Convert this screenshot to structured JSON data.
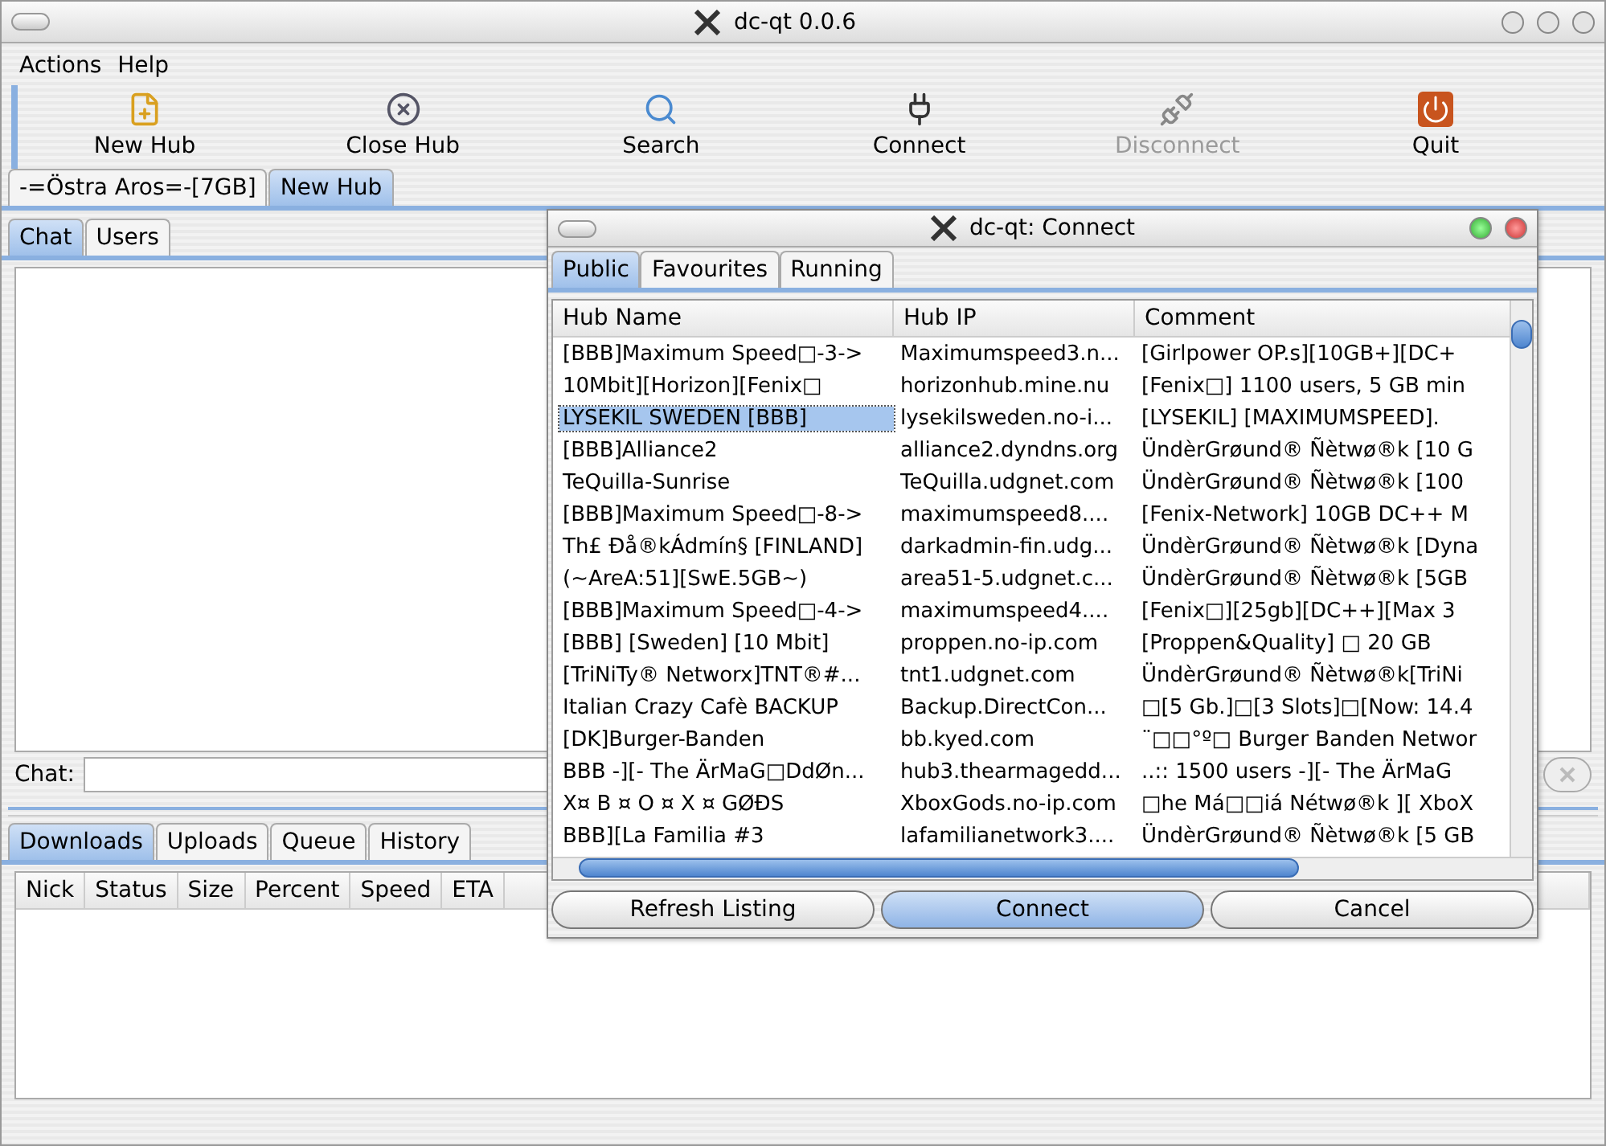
{
  "window": {
    "title": "dc-qt 0.0.6"
  },
  "menu": [
    "Actions",
    "Help"
  ],
  "toolbar": [
    {
      "label": "New Hub",
      "kind": "new",
      "disabled": false
    },
    {
      "label": "Close Hub",
      "kind": "close",
      "disabled": false
    },
    {
      "label": "Search",
      "kind": "search",
      "disabled": false
    },
    {
      "label": "Connect",
      "kind": "connect",
      "disabled": false
    },
    {
      "label": "Disconnect",
      "kind": "disconnect",
      "disabled": true
    },
    {
      "label": "Quit",
      "kind": "quit",
      "disabled": false
    }
  ],
  "hub_tabs": [
    {
      "label": "-=Östra Aros=-[7GB]",
      "selected": false
    },
    {
      "label": "New Hub",
      "selected": true
    }
  ],
  "chat_tabs": [
    {
      "label": "Chat",
      "selected": true
    },
    {
      "label": "Users",
      "selected": false
    }
  ],
  "chat_label": "Chat:",
  "transfer_tabs": [
    {
      "label": "Downloads",
      "selected": true
    },
    {
      "label": "Uploads",
      "selected": false
    },
    {
      "label": "Queue",
      "selected": false
    },
    {
      "label": "History",
      "selected": false
    }
  ],
  "transfer_columns": [
    "Nick",
    "Status",
    "Size",
    "Percent",
    "Speed",
    "ETA"
  ],
  "dialog": {
    "title": "dc-qt: Connect",
    "tabs": [
      {
        "label": "Public",
        "selected": true
      },
      {
        "label": "Favourites",
        "selected": false
      },
      {
        "label": "Running",
        "selected": false
      }
    ],
    "columns": [
      "Hub Name",
      "Hub IP",
      "Comment"
    ],
    "rows": [
      {
        "name": "[BBB]Maximum Speed□-3->",
        "ip": "Maximumspeed3.n...",
        "comment": "[Girlpower OP.s][10GB+][DC+",
        "selected": false
      },
      {
        "name": "10Mbit][Horizon][Fenix□",
        "ip": "horizonhub.mine.nu",
        "comment": "[Fenix□] 1100 users, 5 GB min",
        "selected": false
      },
      {
        "name": "LYSEKIL SWEDEN [BBB]",
        "ip": "lysekilsweden.no-i...",
        "comment": "[LYSEKIL]  [MAXIMUMSPEED].",
        "selected": true
      },
      {
        "name": "[BBB]Alliance2",
        "ip": "alliance2.dyndns.org",
        "comment": "ÜndèrGrøund® Ñètwø®k [10 G",
        "selected": false
      },
      {
        "name": "TeQuilla-Sunrise",
        "ip": "TeQuilla.udgnet.com",
        "comment": "ÜndèrGrøund® Ñètwø®k [100",
        "selected": false
      },
      {
        "name": "[BBB]Maximum Speed□-8->",
        "ip": "maximumspeed8....",
        "comment": "[Fenix-Network] 10GB DC++ M",
        "selected": false
      },
      {
        "name": "Th£ Đå®kÁdmín§ [FINLAND]",
        "ip": "darkadmin-fin.udg...",
        "comment": "ÜndèrGrøund® Ñètwø®k [Dyna",
        "selected": false
      },
      {
        "name": "(~AreA:51][SwE.5GB~)",
        "ip": "area51-5.udgnet.c...",
        "comment": "ÜndèrGrøund® Ñètwø®k [5GB",
        "selected": false
      },
      {
        "name": "[BBB]Maximum Speed□-4->",
        "ip": "maximumspeed4....",
        "comment": "[Fenix□][25gb][DC++][Max 3",
        "selected": false
      },
      {
        "name": "[BBB] [Sweden] [10 Mbit]",
        "ip": "proppen.no-ip.com",
        "comment": "[Proppen&Quality] □ 20 GB",
        "selected": false
      },
      {
        "name": "[TriNiTy® Networx]TNT®#...",
        "ip": "tnt1.udgnet.com",
        "comment": "ÜndèrGrøund® Ñètwø®k[TriNi",
        "selected": false
      },
      {
        "name": "Italian Crazy Cafè BACKUP",
        "ip": "Backup.DirectCon...",
        "comment": "□[5 Gb.]□[3 Slots]□[Now: 14.4",
        "selected": false
      },
      {
        "name": "[DK]Burger-Banden",
        "ip": "bb.kyed.com",
        "comment": "¨□□°º□ Burger Banden Networ",
        "selected": false
      },
      {
        "name": "BBB -][- The ÄrMaG□DdØn...",
        "ip": "hub3.thearmagedd...",
        "comment": "..:: 1500 users -][- The ÄrMaG",
        "selected": false
      },
      {
        "name": "X¤ B ¤ O ¤ X ¤ GØĐS",
        "ip": "XboxGods.no-ip.com",
        "comment": "□he Má□□iá Nétwø®k ][ XboX",
        "selected": false
      },
      {
        "name": "BBB][La Familia #3",
        "ip": "lafamilianetwork3....",
        "comment": "ÜndèrGrøund® Ñètwø®k [5 GB",
        "selected": false
      }
    ],
    "buttons": [
      {
        "label": "Refresh Listing",
        "default": false
      },
      {
        "label": "Connect",
        "default": true
      },
      {
        "label": "Cancel",
        "default": false
      }
    ]
  }
}
